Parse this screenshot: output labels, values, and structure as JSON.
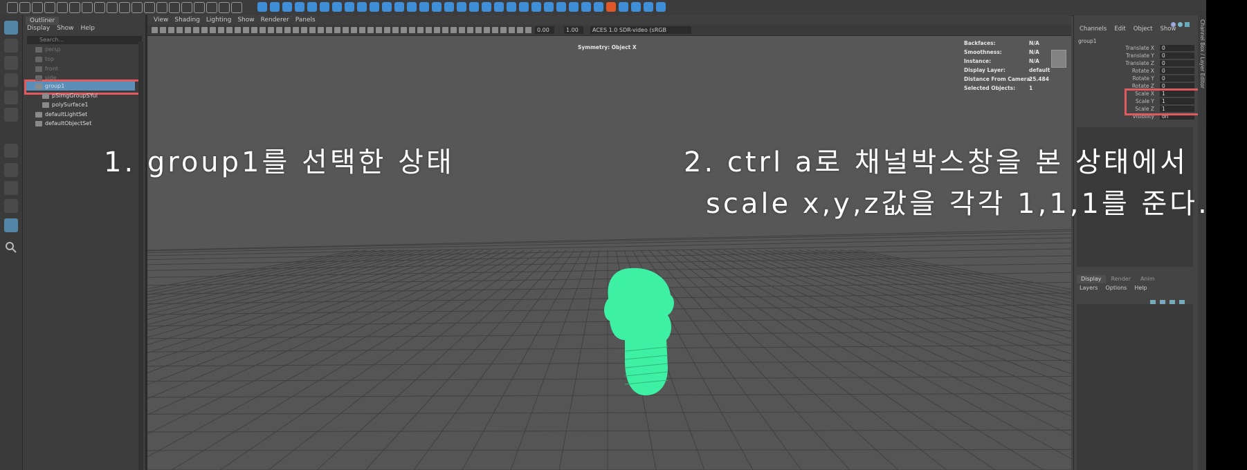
{
  "colors": {
    "selection": "#5b8fb9",
    "highlight_box": "#e05a5f",
    "model": "#3ef0a4",
    "annotation_text": "#ffffff"
  },
  "outliner": {
    "tab": "Outliner",
    "menu": [
      "Display",
      "Show",
      "Help"
    ],
    "search_placeholder": "Search...",
    "items": [
      {
        "label": "persp",
        "icon": "camera-icon",
        "dim": true
      },
      {
        "label": "top",
        "icon": "camera-icon",
        "dim": true
      },
      {
        "label": "front",
        "icon": "camera-icon",
        "dim": true
      },
      {
        "label": "side",
        "icon": "camera-icon",
        "dim": true
      },
      {
        "label": "group1",
        "icon": "group-icon",
        "selected": true
      },
      {
        "label": "pSimgGroupSYul",
        "icon": "transform-icon",
        "child": true
      },
      {
        "label": "polySurface1",
        "icon": "mesh-icon",
        "child": true
      },
      {
        "label": "defaultLightSet",
        "icon": "set-icon"
      },
      {
        "label": "defaultObjectSet",
        "icon": "set-icon"
      }
    ]
  },
  "viewport": {
    "menu": [
      "View",
      "Shading",
      "Lighting",
      "Show",
      "Renderer",
      "Panels"
    ],
    "field1": "0.00",
    "field2": "1.00",
    "color_space": "ACES 1.0 SDR-video (sRGB",
    "symmetry": "Symmetry: Object X",
    "hud": {
      "backfaces_label": "Backfaces:",
      "backfaces_value": "N/A",
      "smoothness_label": "Smoothness:",
      "smoothness_value": "N/A",
      "instance_label": "Instance:",
      "instance_value": "N/A",
      "display_layer_label": "Display Layer:",
      "display_layer_value": "default",
      "distance_label": "Distance From Camera:",
      "distance_value": "25.484",
      "selected_label": "Selected Objects:",
      "selected_value": "1"
    }
  },
  "channel_box": {
    "menu": [
      "Channels",
      "Edit",
      "Object",
      "Show"
    ],
    "object_name": "group1",
    "channels": [
      {
        "label": "Translate X",
        "value": "0"
      },
      {
        "label": "Translate Y",
        "value": "0"
      },
      {
        "label": "Translate Z",
        "value": "0"
      },
      {
        "label": "Rotate X",
        "value": "0"
      },
      {
        "label": "Rotate Y",
        "value": "0"
      },
      {
        "label": "Rotate Z",
        "value": "0"
      },
      {
        "label": "Scale X",
        "value": "1"
      },
      {
        "label": "Scale Y",
        "value": "1"
      },
      {
        "label": "Scale Z",
        "value": "1"
      },
      {
        "label": "Visibility",
        "value": "on"
      }
    ],
    "side_tab": "Channel Box / Layer Editor",
    "layer_tabs": [
      "Display",
      "Render",
      "Anim"
    ],
    "layer_menu": [
      "Layers",
      "Options",
      "Help"
    ]
  },
  "annotations": {
    "step1": "1. group1를 선택한 상태",
    "step2_line1": "2. ctrl a로 채널박스창을 본 상태에서",
    "step2_line2": "scale x,y,z값을 각각 1,1,1를 준다."
  }
}
